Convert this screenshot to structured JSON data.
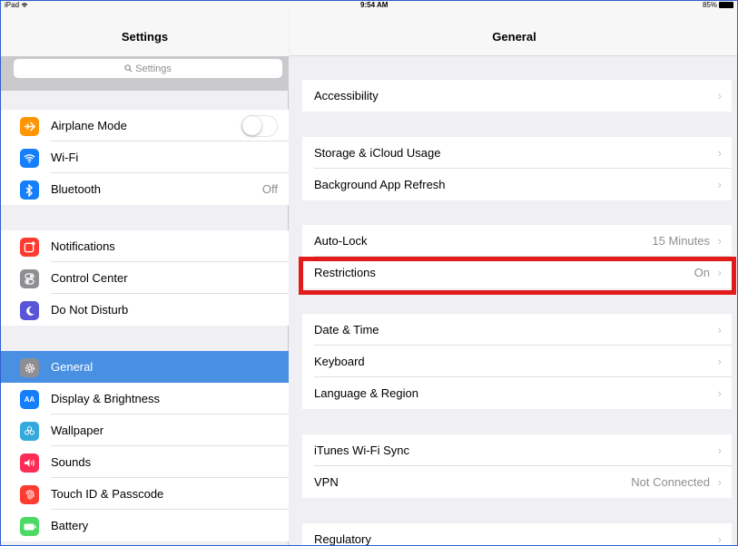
{
  "status_bar": {
    "device": "iPad",
    "time": "9:54 AM",
    "battery": "85%"
  },
  "settings_pane": {
    "title": "Settings",
    "search": {
      "placeholder": "Settings"
    },
    "groups": [
      {
        "items": [
          {
            "label": "Airplane Mode",
            "icon": "airplane-icon",
            "color": "#ff9500",
            "toggle": false
          },
          {
            "label": "Wi-Fi",
            "icon": "wifi-icon",
            "color": "#147efb"
          },
          {
            "label": "Bluetooth",
            "icon": "bluetooth-icon",
            "color": "#147efb",
            "value": "Off"
          }
        ]
      },
      {
        "items": [
          {
            "label": "Notifications",
            "icon": "notifications-icon",
            "color": "#ff3b30"
          },
          {
            "label": "Control Center",
            "icon": "control-center-icon",
            "color": "#8e8e93"
          },
          {
            "label": "Do Not Disturb",
            "icon": "moon-icon",
            "color": "#5856d6"
          }
        ]
      },
      {
        "items": [
          {
            "label": "General",
            "icon": "gear-icon",
            "color": "#8e8e93",
            "selected": true
          },
          {
            "label": "Display & Brightness",
            "icon": "display-icon",
            "color": "#147efb"
          },
          {
            "label": "Wallpaper",
            "icon": "wallpaper-icon",
            "color": "#34aadc"
          },
          {
            "label": "Sounds",
            "icon": "speaker-icon",
            "color": "#ff2d55"
          },
          {
            "label": "Touch ID & Passcode",
            "icon": "fingerprint-icon",
            "color": "#ff3b30"
          },
          {
            "label": "Battery",
            "icon": "battery-icon",
            "color": "#4cd964"
          }
        ]
      }
    ]
  },
  "general_pane": {
    "title": "General",
    "groups": [
      {
        "items": [
          {
            "label": "Accessibility"
          }
        ]
      },
      {
        "items": [
          {
            "label": "Storage & iCloud Usage"
          },
          {
            "label": "Background App Refresh"
          }
        ]
      },
      {
        "items": [
          {
            "label": "Auto-Lock",
            "value": "15 Minutes"
          },
          {
            "label": "Restrictions",
            "value": "On"
          }
        ]
      },
      {
        "items": [
          {
            "label": "Date & Time"
          },
          {
            "label": "Keyboard"
          },
          {
            "label": "Language & Region"
          }
        ]
      },
      {
        "items": [
          {
            "label": "iTunes Wi-Fi Sync"
          },
          {
            "label": "VPN",
            "value": "Not Connected"
          }
        ]
      },
      {
        "items": [
          {
            "label": "Regulatory"
          }
        ]
      }
    ],
    "chevron": "›"
  },
  "highlight_color": "#e21b1b"
}
